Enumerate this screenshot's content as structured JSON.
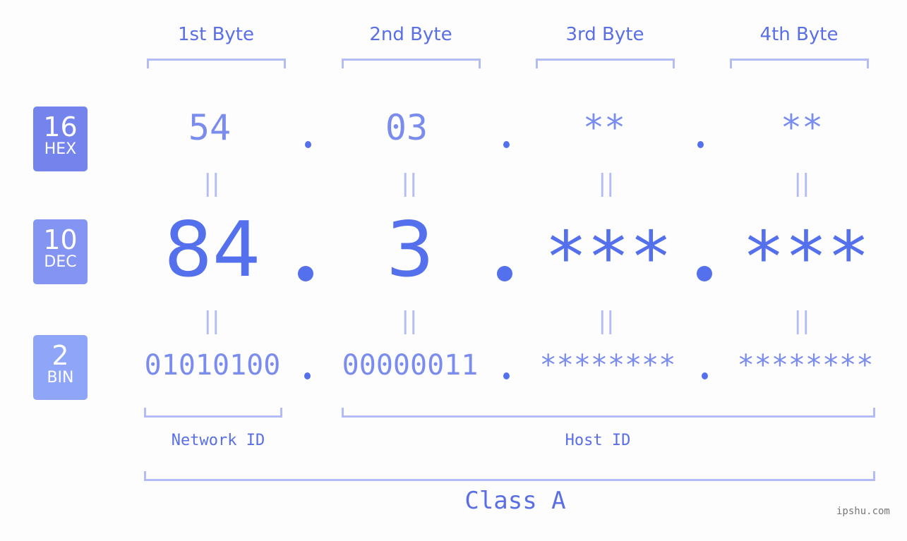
{
  "byte_headers": [
    "1st Byte",
    "2nd Byte",
    "3rd Byte",
    "4th Byte"
  ],
  "rows": {
    "hex": {
      "base": "16",
      "name": "HEX",
      "color": "#7584ec",
      "values": [
        "54",
        "03",
        "**",
        "**"
      ]
    },
    "dec": {
      "base": "10",
      "name": "DEC",
      "color": "#8394f2",
      "values": [
        "84",
        "3",
        "***",
        "***"
      ]
    },
    "bin": {
      "base": "2",
      "name": "BIN",
      "color": "#8fa5f8",
      "values": [
        "01010100",
        "00000011",
        "********",
        "********"
      ]
    }
  },
  "equals_sign": "||",
  "segments": {
    "network_label": "Network ID",
    "host_label": "Host ID"
  },
  "class_label": "Class A",
  "watermark": "ipshu.com",
  "colors": {
    "accent": "#5570ec",
    "light_accent": "#7b8cef",
    "bracket": "#b3bcf5",
    "background": "#fcfdfc"
  }
}
